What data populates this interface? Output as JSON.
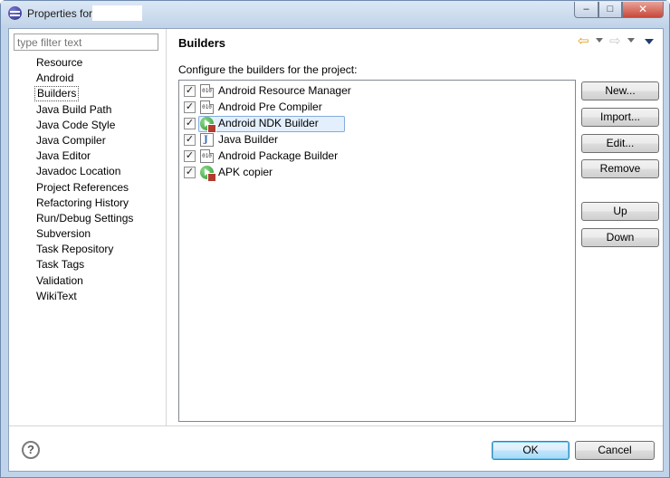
{
  "window": {
    "title": "Properties for",
    "controls": {
      "minimize": "–",
      "maximize": "□",
      "close": "✕"
    }
  },
  "sidebar": {
    "filter_placeholder": "type filter text",
    "items": [
      {
        "label": "Resource"
      },
      {
        "label": "Android"
      },
      {
        "label": "Builders",
        "selected": true
      },
      {
        "label": "Java Build Path"
      },
      {
        "label": "Java Code Style"
      },
      {
        "label": "Java Compiler"
      },
      {
        "label": "Java Editor"
      },
      {
        "label": "Javadoc Location"
      },
      {
        "label": "Project References"
      },
      {
        "label": "Refactoring History"
      },
      {
        "label": "Run/Debug Settings"
      },
      {
        "label": "Subversion"
      },
      {
        "label": "Task Repository"
      },
      {
        "label": "Task Tags"
      },
      {
        "label": "Validation"
      },
      {
        "label": "WikiText"
      }
    ]
  },
  "page": {
    "title": "Builders",
    "description": "Configure the builders for the project:",
    "history_back_icon": "back-arrow-icon",
    "history_forward_icon": "forward-arrow-icon"
  },
  "builders": [
    {
      "label": "Android Resource Manager",
      "checked": true,
      "icon": "binary-file-icon",
      "icon_text": "010"
    },
    {
      "label": "Android Pre Compiler",
      "checked": true,
      "icon": "binary-file-icon",
      "icon_text": "010"
    },
    {
      "label": "Android NDK Builder",
      "checked": true,
      "icon": "external-tool-icon",
      "selected": true
    },
    {
      "label": "Java Builder",
      "checked": true,
      "icon": "java-builder-icon"
    },
    {
      "label": "Android Package Builder",
      "checked": true,
      "icon": "binary-file-icon",
      "icon_text": "010"
    },
    {
      "label": "APK copier",
      "checked": true,
      "icon": "external-tool-icon"
    }
  ],
  "buttons": {
    "new": "New...",
    "import": "Import...",
    "edit": "Edit...",
    "remove": "Remove",
    "up": "Up",
    "down": "Down",
    "ok": "OK",
    "cancel": "Cancel",
    "help": "?"
  },
  "colors": {
    "window_frame": "#bfd4ea",
    "selection_highlight": "#e3effc",
    "default_button": "#bee6fd"
  }
}
